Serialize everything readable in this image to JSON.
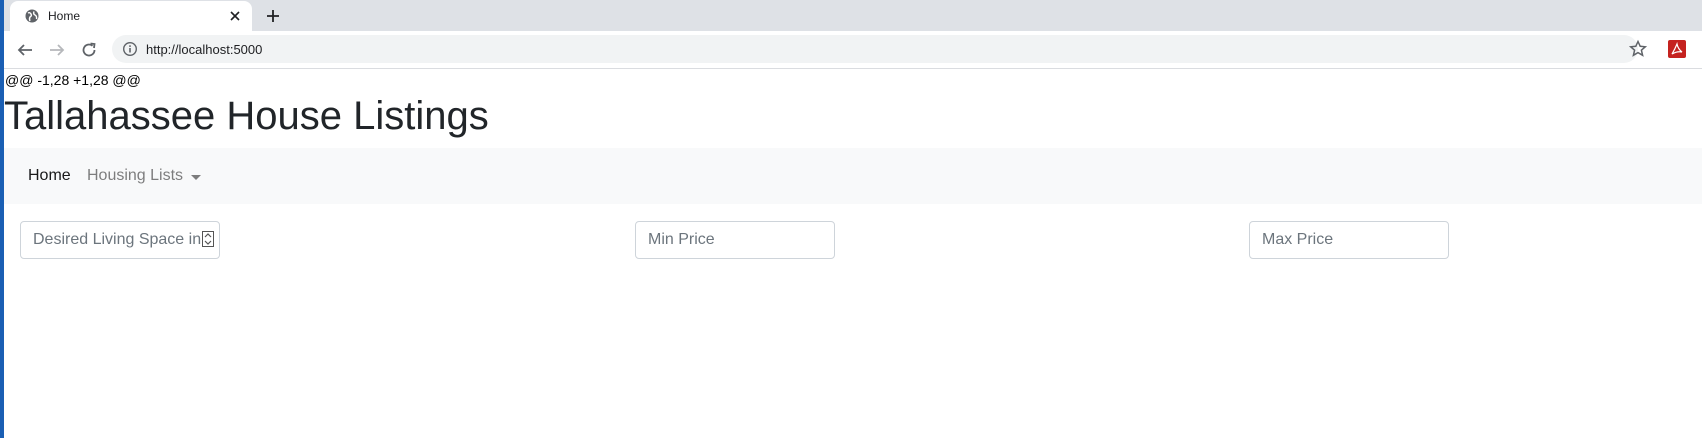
{
  "browser": {
    "tab_title": "Home",
    "url": "http://localhost:5000",
    "icons": [
      "globe-icon",
      "close-icon",
      "plus-icon",
      "back-icon",
      "forward-icon",
      "reload-icon",
      "info-icon",
      "star-icon",
      "pdf-icon"
    ]
  },
  "page": {
    "diff_text": "@@ -1,28 +1,28 @@",
    "title": "Tallahassee House Listings"
  },
  "navbar": {
    "home_label": "Home",
    "dropdown_label": "Housing Lists"
  },
  "filters": {
    "living_space_placeholder": "Desired Living Space in sqft",
    "min_price_placeholder": "Min Price",
    "max_price_placeholder": "Max Price"
  },
  "colors": {
    "accent_strip": "#1a5fb4",
    "navbar_bg": "#f8f9fa",
    "pdf_red": "#c5221f"
  }
}
